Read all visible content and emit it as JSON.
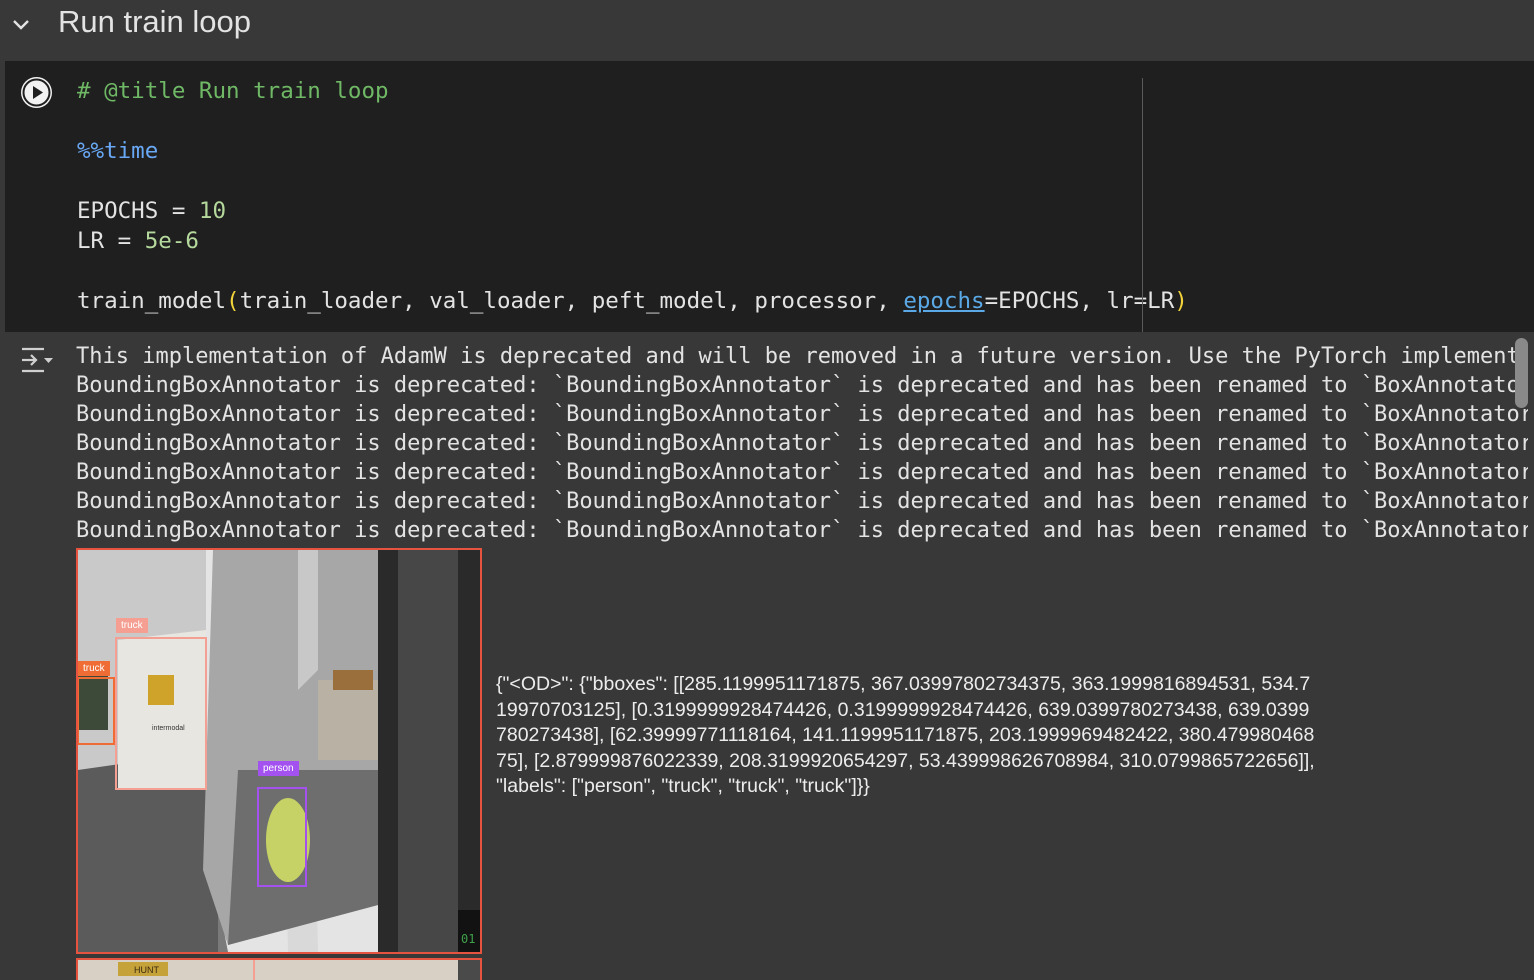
{
  "section": {
    "title": "Run train loop"
  },
  "code": {
    "comment": "# @title Run train loop",
    "magic": "%%time",
    "epochs_name": "EPOCHS",
    "epochs_value": "10",
    "lr_name": "LR",
    "lr_value": "5e-6",
    "call_func": "train_model",
    "call_args": "train_loader, val_loader, peft_model, processor, ",
    "kw_epochs": "epochs",
    "call_rest": "=EPOCHS, lr=LR",
    "equals": " = "
  },
  "output": {
    "lines": [
      "This implementation of AdamW is deprecated and will be removed in a future version. Use the PyTorch implementation",
      "BoundingBoxAnnotator is deprecated: `BoundingBoxAnnotator` is deprecated and has been renamed to `BoxAnnotator`",
      "BoundingBoxAnnotator is deprecated: `BoundingBoxAnnotator` is deprecated and has been renamed to `BoxAnnotator`",
      "BoundingBoxAnnotator is deprecated: `BoundingBoxAnnotator` is deprecated and has been renamed to `BoxAnnotator`",
      "BoundingBoxAnnotator is deprecated: `BoundingBoxAnnotator` is deprecated and has been renamed to `BoxAnnotator`",
      "BoundingBoxAnnotator is deprecated: `BoundingBoxAnnotator` is deprecated and has been renamed to `BoxAnnotator`",
      "BoundingBoxAnnotator is deprecated: `BoundingBoxAnnotator` is deprecated and has been renamed to `BoxAnnotator`"
    ],
    "json_result": "{\"<OD>\": {\"bboxes\": [[285.1199951171875, 367.03997802734375, 363.1999816894531, 534.719970703125], [0.3199999928474426, 0.3199999928474426, 639.0399780273438, 639.0399780273438], [62.39999771118164, 141.1199951171875, 203.1999969482422, 380.47998046875], [2.879999876022339, 208.3199920654297, 53.439998626708984, 310.0799865722656]], \"labels\": [\"person\", \"truck\", \"truck\", \"truck\"]}}",
    "detections": [
      {
        "label": "truck",
        "color": "#f59f93"
      },
      {
        "label": "truck",
        "color": "#ef6d35"
      },
      {
        "label": "person",
        "color": "#a352f0"
      }
    ],
    "image_text": {
      "trailer_logo": "HUNT",
      "dash_readout": "01",
      "trailer_sign": "intermodal"
    }
  },
  "colors": {
    "accent": "#e6533f",
    "comment": "#6fb865",
    "number": "#b5d99c",
    "magic": "#69a8f5"
  }
}
